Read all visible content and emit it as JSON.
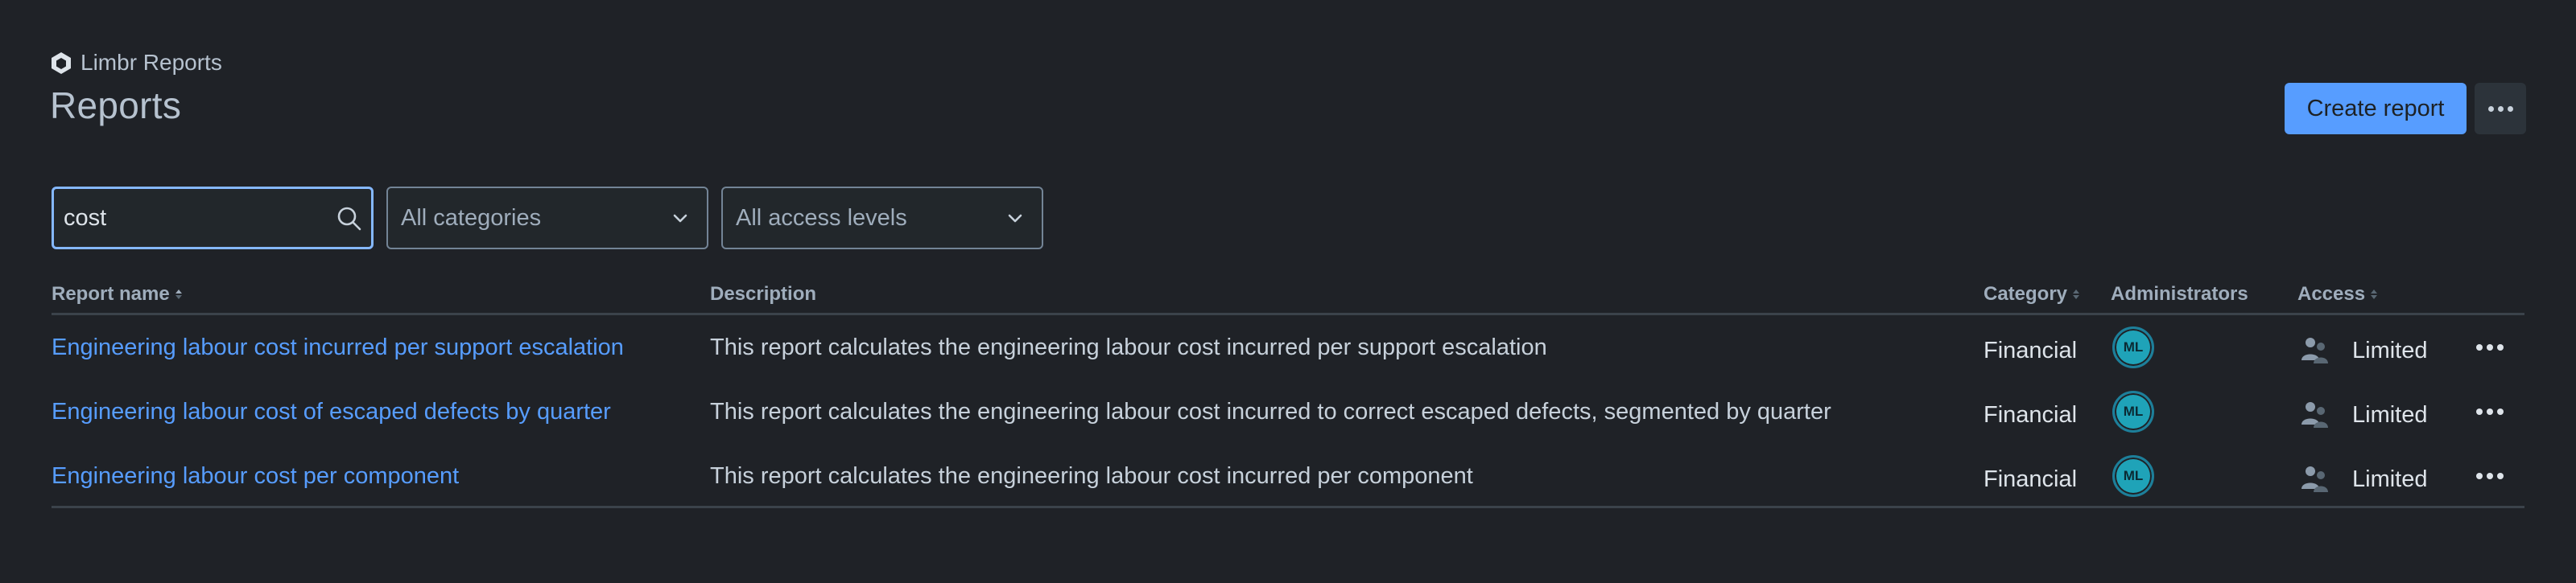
{
  "breadcrumb": {
    "label": "Limbr Reports"
  },
  "page": {
    "title": "Reports"
  },
  "actions": {
    "create_label": "Create report"
  },
  "filters": {
    "search_value": "cost",
    "category_selected": "All categories",
    "access_selected": "All access levels"
  },
  "table": {
    "headers": {
      "name": "Report name",
      "description": "Description",
      "category": "Category",
      "administrators": "Administrators",
      "access": "Access"
    },
    "rows": [
      {
        "name": "Engineering labour cost incurred per support escalation",
        "description": "This report calculates the engineering labour cost incurred per support escalation",
        "category": "Financial",
        "admin_initials": "ML",
        "access": "Limited"
      },
      {
        "name": "Engineering labour cost of escaped defects by quarter",
        "description": "This report calculates the engineering labour cost incurred to correct escaped defects, segmented by quarter",
        "category": "Financial",
        "admin_initials": "ML",
        "access": "Limited"
      },
      {
        "name": "Engineering labour cost per component",
        "description": "This report calculates the engineering labour cost incurred per component",
        "category": "Financial",
        "admin_initials": "ML",
        "access": "Limited"
      }
    ]
  },
  "colors": {
    "background": "#1f2227",
    "accent": "#579dff",
    "link": "#579dff",
    "avatar": "#1fa3b8"
  },
  "icons": {
    "logo": "hexagon-logo-icon",
    "search": "search-icon",
    "chevron": "chevron-down-icon",
    "sort": "sort-icon",
    "people": "people-icon",
    "more": "more-icon"
  }
}
